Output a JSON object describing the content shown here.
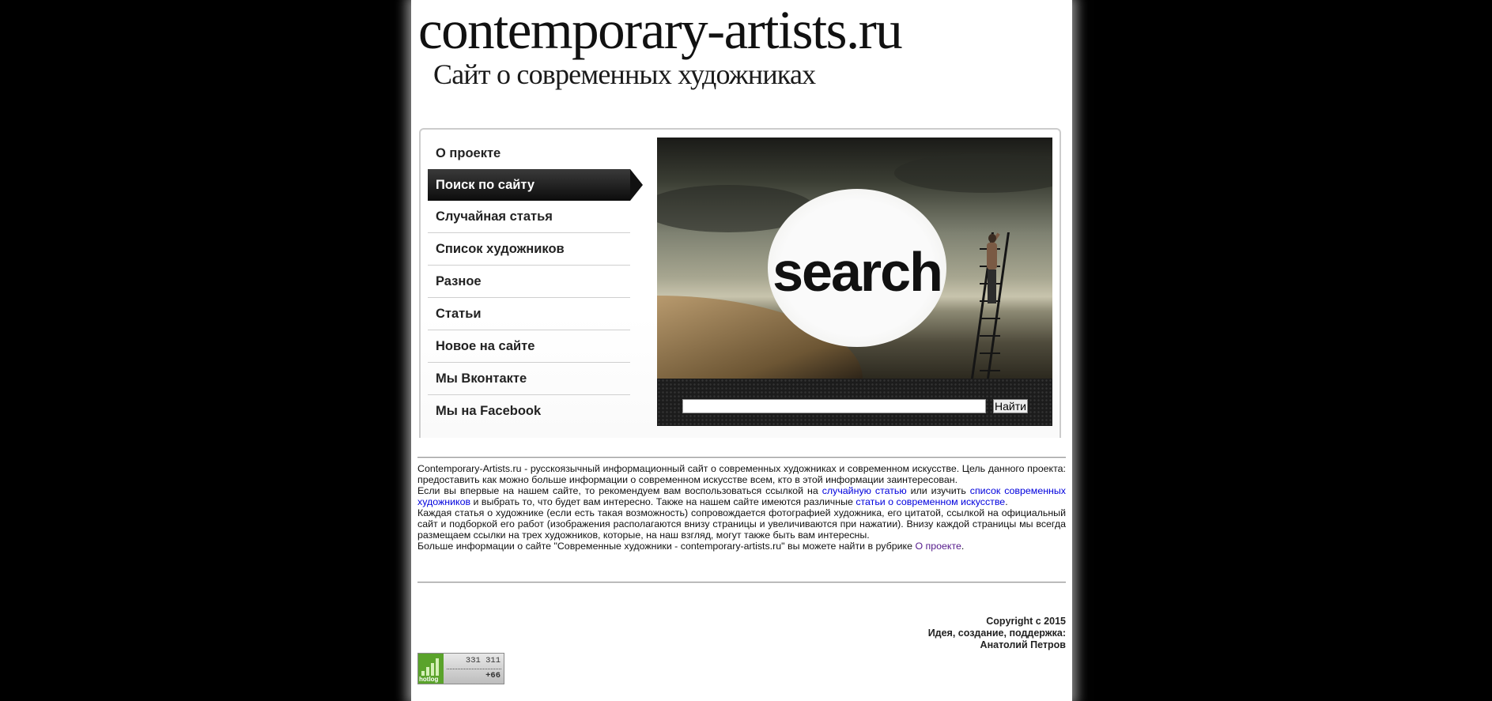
{
  "header": {
    "site_title": "contemporary-artists.ru",
    "subtitle": "Сайт о современных художниках"
  },
  "menu": {
    "items": [
      {
        "label": "О проекте"
      },
      {
        "label": "Поиск по сайту",
        "active": true
      },
      {
        "label": "Случайная статья"
      },
      {
        "label": "Список художников"
      },
      {
        "label": "Разное"
      },
      {
        "label": "Статьи"
      },
      {
        "label": "Новое на сайте"
      },
      {
        "label": "Мы Вконтакте"
      },
      {
        "label": "Мы на Facebook"
      }
    ]
  },
  "search": {
    "banner_text": "search",
    "input_value": "",
    "button_label": "Найти"
  },
  "intro": {
    "p1": "Contemporary-Artists.ru - русскоязычный информационный сайт о современных художниках и современном искусстве. Цель данного проекта: предоставить как можно больше информации о современном искусстве всем, кто в этой информации заинтересован.",
    "p2_a": "Если вы впервые на нашем сайте, то рекомендуем вам воспользоваться ссылкой на ",
    "p2_link1": "случайную статью",
    "p2_b": " или изучить ",
    "p2_link2": "список современных художников",
    "p2_c": " и выбрать то, что будет вам интересно. Также на нашем сайте имеются различные ",
    "p2_link3": "статьи о современном искусстве",
    "p2_d": ".",
    "p3": "Каждая статья о художнике (если есть такая возможность) сопровождается фотографией художника, его цитатой, ссылкой на официальный сайт и подборкой его работ (изображения располагаются внизу страницы и увеличиваются при нажатии). Внизу каждой страницы мы всегда размещаем ссылки на трех художников, которые, на наш взгляд, могут также быть вам интересны.",
    "p4_a": "Больше информации о сайте \"Современные художники - contemporary-artists.ru\" вы можете найти в рубрике ",
    "p4_link": "О проекте",
    "p4_b": "."
  },
  "footer": {
    "copyright": "Copyright с 2015",
    "credits_label": "Идея, создание, поддержка:",
    "author": "Анатолий Петров"
  },
  "counter": {
    "brand": "hotlog",
    "total": "331 311",
    "today": "+66"
  },
  "colors": {
    "link": "#0000dd",
    "visited_link": "#551a8b",
    "page_bg": "#000000",
    "content_bg": "#ffffff"
  }
}
